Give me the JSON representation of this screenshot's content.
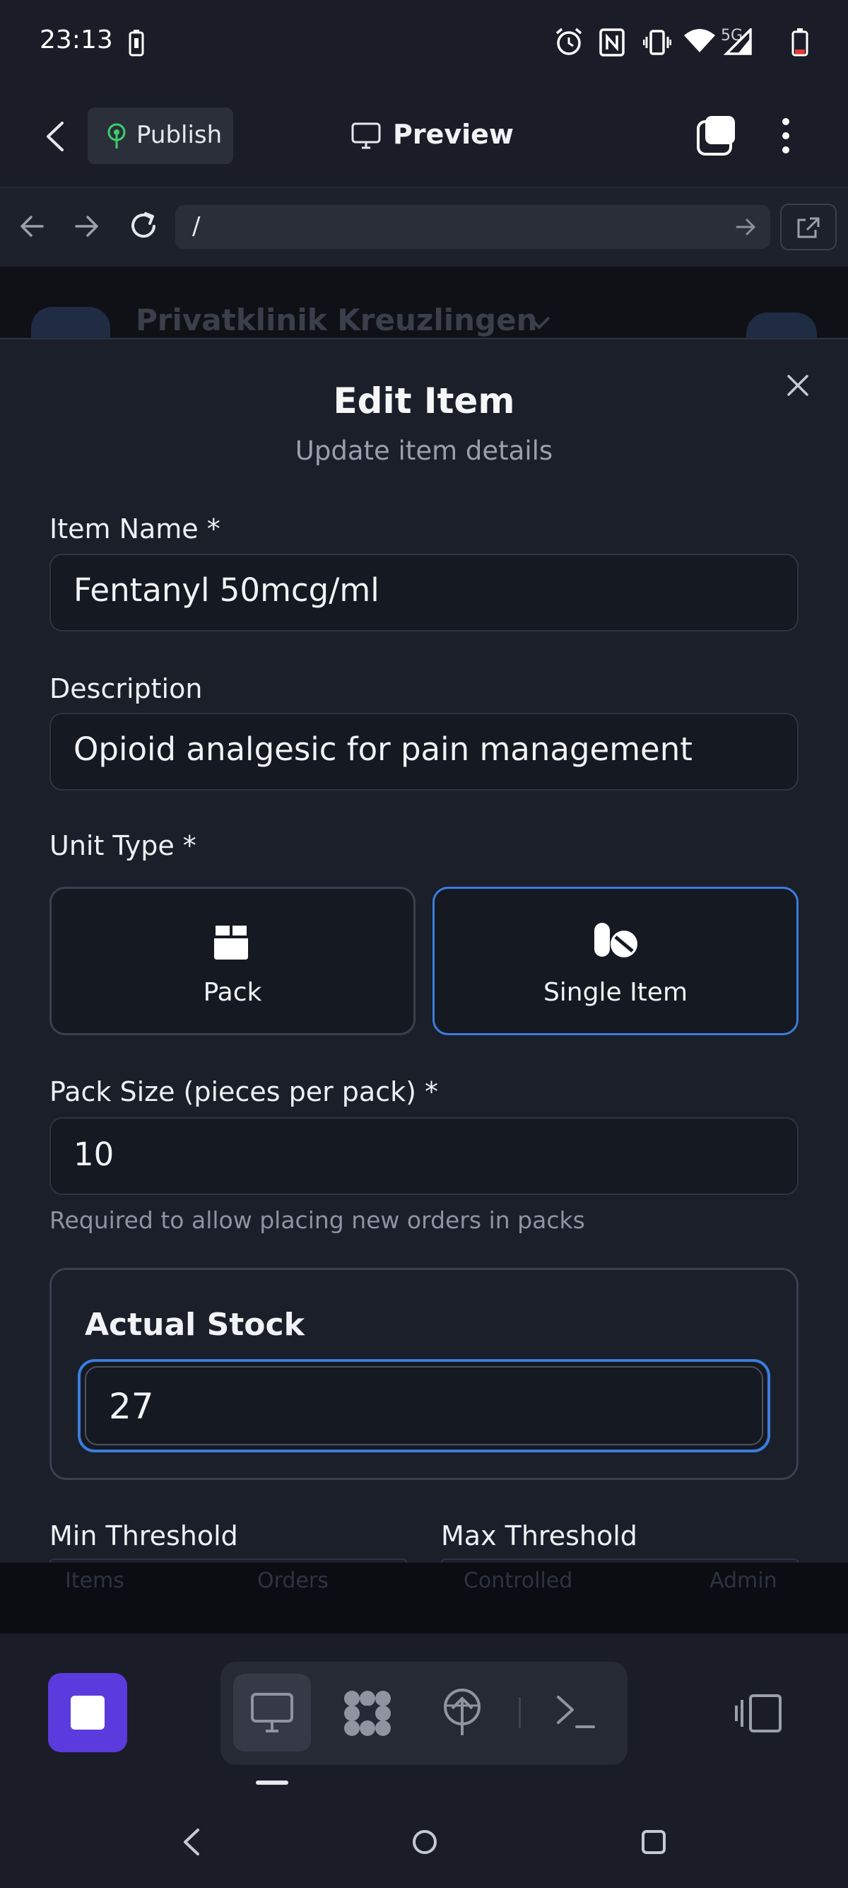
{
  "status_bar": {
    "time": "23:13",
    "network": "5G",
    "icons": [
      "battery-saver-icon",
      "alarm-icon",
      "nfc-icon",
      "vibrate-icon",
      "wifi-icon",
      "signal-icon",
      "battery-icon"
    ]
  },
  "app_bar": {
    "publish_label": "Publish",
    "preview_label": "Preview"
  },
  "url_bar": {
    "url": "/"
  },
  "background_page": {
    "clinic_name": "Privatklinik Kreuzlingen",
    "tabs": [
      "Items",
      "Orders",
      "Controlled",
      "Admin"
    ]
  },
  "modal": {
    "title": "Edit Item",
    "subtitle": "Update item details",
    "fields": {
      "item_name": {
        "label": "Item Name *",
        "value": "Fentanyl 50mcg/ml"
      },
      "description": {
        "label": "Description",
        "value": "Opioid analgesic for pain management"
      },
      "unit_type": {
        "label": "Unit Type *",
        "options": [
          {
            "label": "Pack",
            "icon": "box-icon",
            "selected": false
          },
          {
            "label": "Single Item",
            "icon": "pills-icon",
            "selected": true
          }
        ]
      },
      "pack_size": {
        "label": "Pack Size (pieces per pack) *",
        "value": "10",
        "hint": "Required to allow placing new orders in packs"
      },
      "actual_stock": {
        "label": "Actual Stock",
        "value": "27"
      },
      "min_threshold": {
        "label": "Min Threshold"
      },
      "max_threshold": {
        "label": "Max Threshold"
      }
    }
  },
  "colors": {
    "accent": "#3b7ddd",
    "stop_button": "#5b3bdd",
    "background": "#181c26"
  }
}
